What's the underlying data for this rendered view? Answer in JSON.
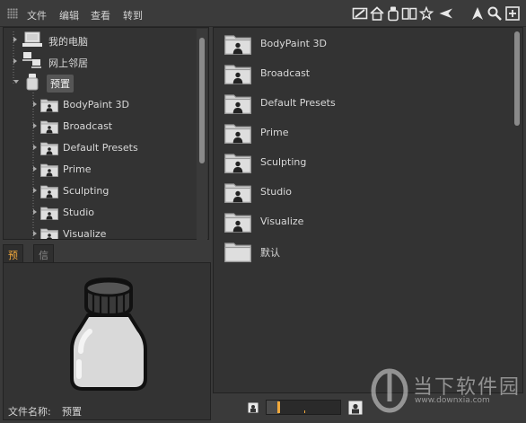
{
  "menu": {
    "items": [
      "文件",
      "编辑",
      "查看",
      "转到"
    ]
  },
  "toolbar": {
    "icons": [
      "edit-icon",
      "home-icon",
      "bottle-icon",
      "book-icon",
      "star-icon",
      "back-icon",
      "up-icon",
      "search-icon",
      "new-icon"
    ]
  },
  "tree": {
    "computer": "我的电脑",
    "network": "网上邻居",
    "presets": "预置",
    "children": [
      "BodyPaint 3D",
      "Broadcast",
      "Default Presets",
      "Prime",
      "Sculpting",
      "Studio",
      "Visualize"
    ]
  },
  "tabs": {
    "preview": "预览",
    "info": "信息"
  },
  "preview": {
    "filename_label": "文件名称:",
    "filename_value": "预置"
  },
  "right": {
    "items": [
      "BodyPaint 3D",
      "Broadcast",
      "Default Presets",
      "Prime",
      "Sculpting",
      "Studio",
      "Visualize",
      "默认"
    ]
  },
  "zoom": {
    "level": 0.17
  },
  "watermark": {
    "text": "当下软件园",
    "url": "www.downxia.com"
  },
  "colors": {
    "accent": "#f2a93b",
    "background": "#333333"
  }
}
